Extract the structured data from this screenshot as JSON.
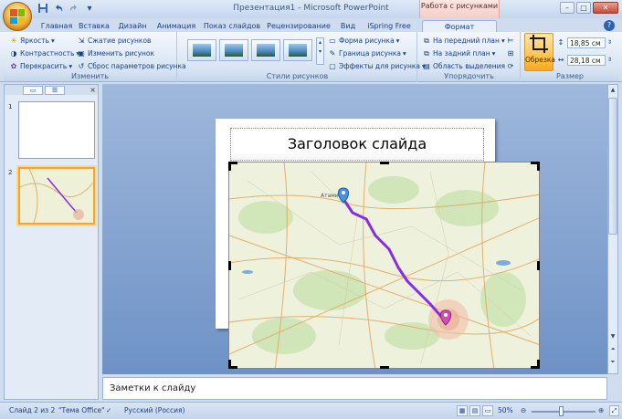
{
  "window": {
    "title": "Презентация1 - Microsoft PowerPoint",
    "context_tab_header": "Работа с рисунками",
    "controls": {
      "minimize": "–",
      "maximize": "□",
      "close": "✕"
    }
  },
  "quick_access": {
    "save_icon": "save-icon",
    "undo_icon": "undo-icon",
    "redo_icon": "redo-icon",
    "customize_icon": "dropdown-icon"
  },
  "tabs": [
    {
      "label": "Главная"
    },
    {
      "label": "Вставка"
    },
    {
      "label": "Дизайн"
    },
    {
      "label": "Анимация"
    },
    {
      "label": "Показ слайдов"
    },
    {
      "label": "Рецензирование"
    },
    {
      "label": "Вид"
    },
    {
      "label": "iSpring Free"
    },
    {
      "label": "Формат"
    }
  ],
  "active_tab": "Формат",
  "ribbon": {
    "adjust": {
      "label": "Изменить",
      "brightness": "Яркость",
      "contrast": "Контрастность",
      "recolor": "Перекрасить",
      "compress": "Сжатие рисунков",
      "change": "Изменить рисунок",
      "reset": "Сброс параметров рисунка"
    },
    "styles": {
      "label": "Стили рисунков",
      "shape": "Форма рисунка",
      "border": "Граница рисунка",
      "effects": "Эффекты для рисунка"
    },
    "arrange": {
      "label": "Упорядочить",
      "front": "На передний план",
      "back": "На задний план",
      "selection": "Область выделения"
    },
    "size": {
      "label": "Размер",
      "crop": "Обрезка",
      "height": "18,85 см",
      "width": "28,18 см"
    }
  },
  "slides_pane": {
    "slide_numbers": [
      "1",
      "2"
    ]
  },
  "slide": {
    "title": "Заголовок слайда",
    "map_labels": [
      "Атами"
    ]
  },
  "notes": {
    "placeholder": "Заметки к слайду"
  },
  "status": {
    "slide_counter": "Слайд 2 из 2",
    "theme": "\"Тема Office\"",
    "language": "Русский (Россия)",
    "zoom": "50%",
    "zoom_level_percent": 50
  },
  "colors": {
    "ribbon_text": "#15428b",
    "context_tab": "#f6c9c4",
    "crop_active": "#ffc451",
    "route": "#8a2be2",
    "selection_border": "#f2a43a"
  }
}
